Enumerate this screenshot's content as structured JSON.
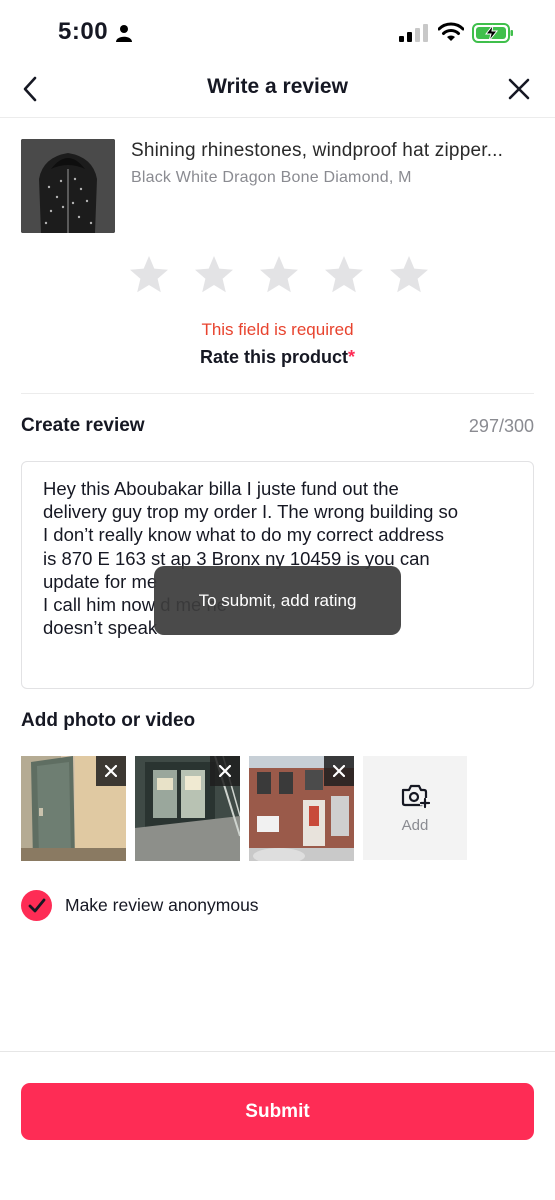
{
  "status_bar": {
    "time": "5:00",
    "icons": [
      "person-icon",
      "signal-icon",
      "wifi-icon",
      "battery-charging-icon"
    ]
  },
  "header": {
    "title": "Write a review",
    "back_icon": "chevron-left-icon",
    "close_icon": "close-icon"
  },
  "product": {
    "title": "Shining rhinestones, windproof hat zipper...",
    "variant": "Black White Dragon Bone Diamond, M"
  },
  "rating": {
    "stars_total": 5,
    "stars_selected": 0,
    "error": "This field is required",
    "label": "Rate this product",
    "required_mark": "*"
  },
  "review": {
    "label": "Create review",
    "char_count": "297/300",
    "text": "Hey this Aboubakar billa I juste fund out the\ndelivery guy trop my order I. The wrong building so\nI don’t really know what to do my correct address\nis 870  E 163 st ap 3 Bronx ny 10459 is you can\nupdate for me\nI call him now                                    d me he\ndoesn’t speak"
  },
  "toast": {
    "message": "To submit, add rating"
  },
  "media": {
    "label": "Add photo or video",
    "items": [
      {
        "name": "hallway-photo",
        "remove_icon": "close-icon"
      },
      {
        "name": "building-entrance-photo",
        "remove_icon": "close-icon"
      },
      {
        "name": "brick-building-photo",
        "remove_icon": "close-icon"
      }
    ],
    "add_label": "Add",
    "add_icon": "camera-plus-icon"
  },
  "anonymous": {
    "label": "Make review anonymous",
    "checked": true
  },
  "submit": {
    "label": "Submit"
  },
  "colors": {
    "accent": "#fe2c55",
    "error": "#e8432e",
    "muted": "#8a8b91",
    "star": "#e3e3e5"
  }
}
